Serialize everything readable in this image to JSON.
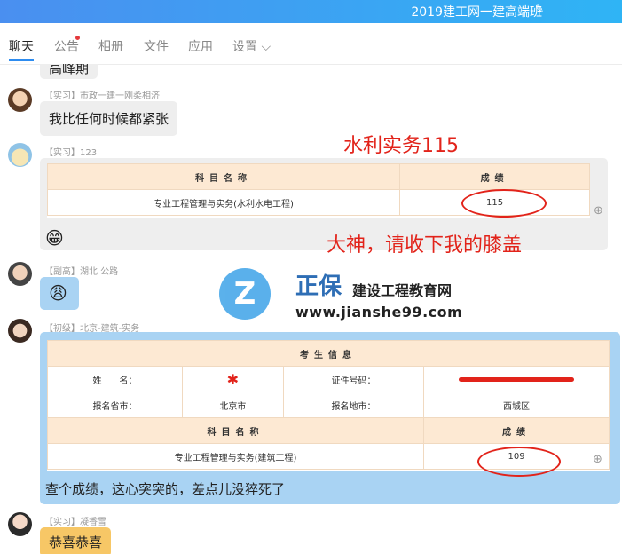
{
  "header": {
    "group_title": "2019建工网一建高端班",
    "edit_icon": "pencil-icon"
  },
  "tabs": [
    {
      "label": "聊天"
    },
    {
      "label": "公告"
    },
    {
      "label": "相册"
    },
    {
      "label": "文件"
    },
    {
      "label": "应用"
    },
    {
      "label": "设置 ⌵"
    }
  ],
  "messages": {
    "m0": {
      "text": "高峰期"
    },
    "m1": {
      "sender": "【实习】市政一建一刚柔相济",
      "text": "我比任何时候都紧张"
    },
    "m2": {
      "sender": "【实习】123",
      "table_header": [
        "科目名称",
        "成绩"
      ],
      "row": [
        "专业工程管理与实务(水利水电工程)",
        "115"
      ],
      "annotation_top": "水利实务115",
      "annotation_bottom": "大神，请收下我的膝盖"
    },
    "m3": {
      "sender": "【副高】湖北 公路"
    },
    "m4": {
      "sender": "【初级】北京-建筑-实务",
      "section_title": "考生信息",
      "row1": [
        "姓　　名：",
        "证件号码："
      ],
      "row2": [
        "报名省市：",
        "北京市",
        "报名地市：",
        "西城区"
      ],
      "subject_header": [
        "科目名称",
        "成绩"
      ],
      "subject_row": [
        "专业工程管理与实务(建筑工程)",
        "109"
      ],
      "text": "查个成绩，这心突突的，差点儿没猝死了"
    },
    "m5": {
      "sender": "【实习】凝香雪",
      "text": "恭喜恭喜"
    }
  },
  "watermark": {
    "brand": "正保",
    "name": "建设工程教育网",
    "url": "www.jianshe99.com"
  },
  "colors": {
    "accent": "#2d8cf0",
    "annotation": "#e2231a",
    "table_header": "#fde9d3"
  }
}
